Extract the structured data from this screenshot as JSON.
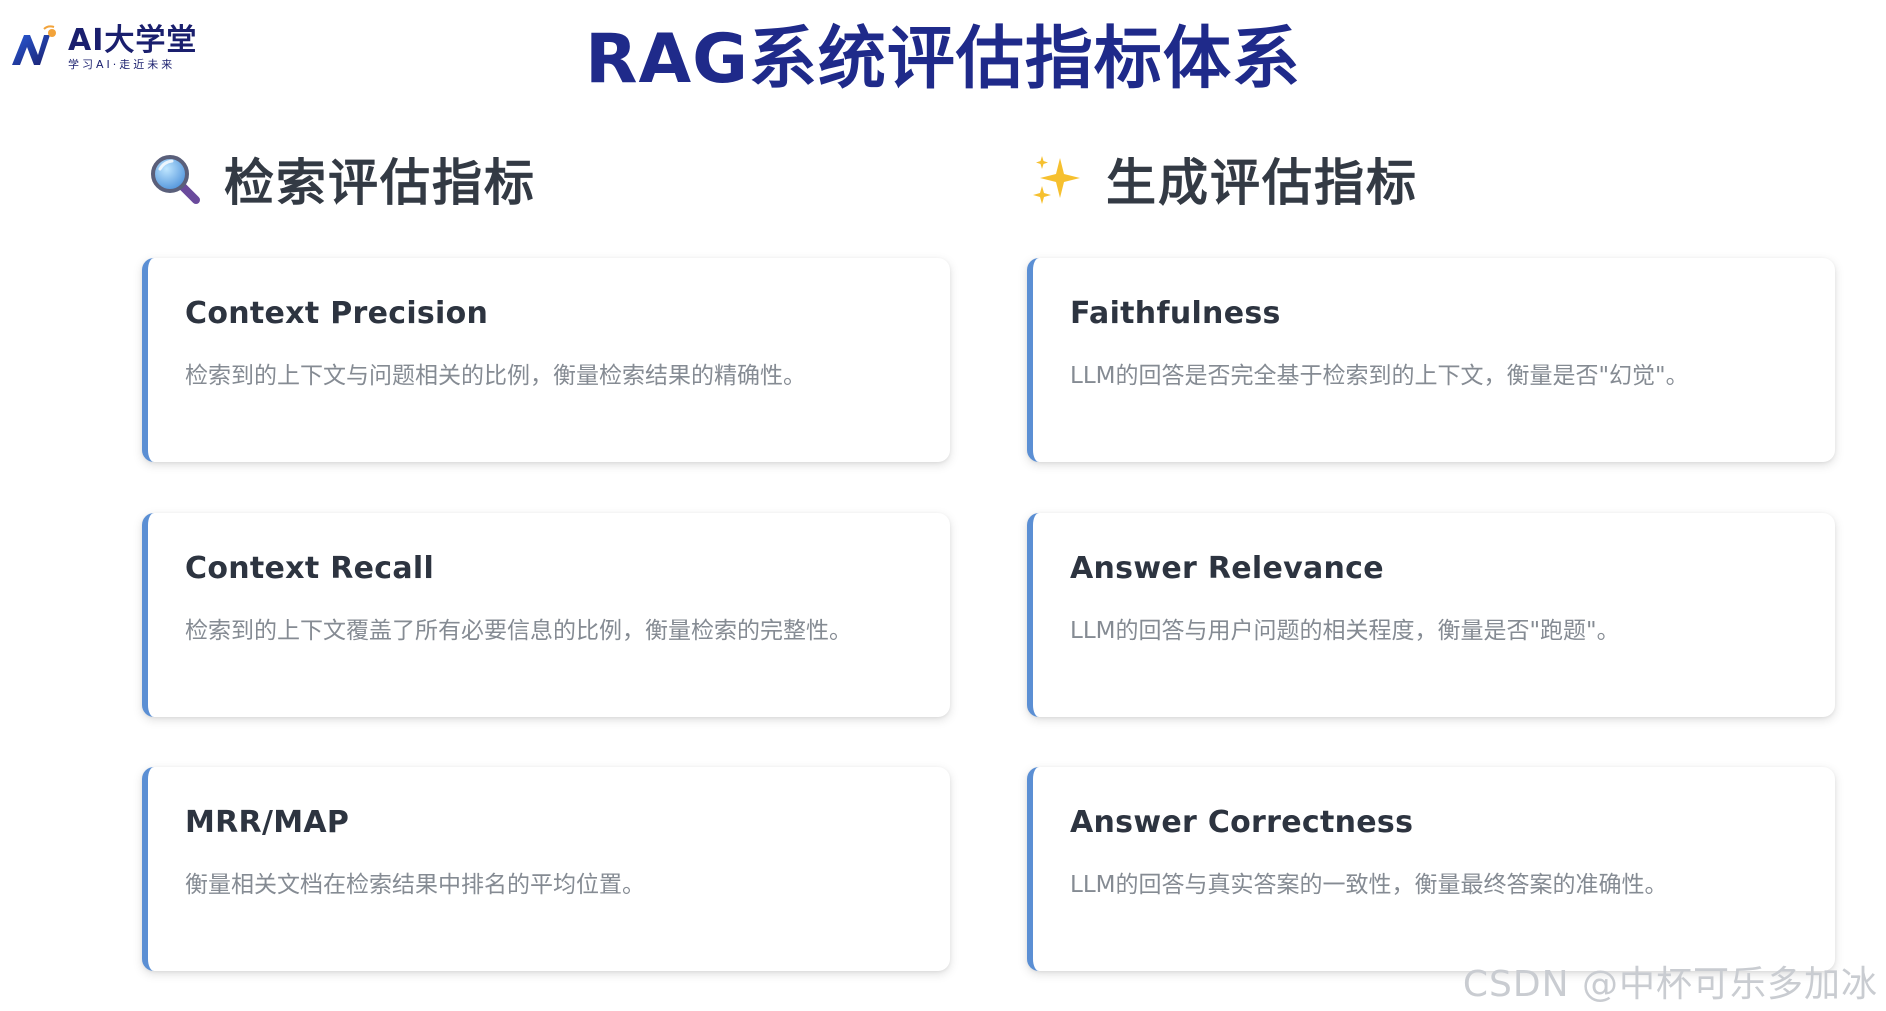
{
  "logo": {
    "title": "AI大学堂",
    "subtitle": "学习AI·走近未来"
  },
  "page_title": "RAG系统评估指标体系",
  "sections": {
    "retrieval": {
      "icon": "magnifying-glass-icon",
      "title": "检索评估指标",
      "cards": [
        {
          "title": "Context Precision",
          "description": "检索到的上下文与问题相关的比例，衡量检索结果的精确性。"
        },
        {
          "title": "Context Recall",
          "description": "检索到的上下文覆盖了所有必要信息的比例，衡量检索的完整性。"
        },
        {
          "title": "MRR/MAP",
          "description": "衡量相关文档在检索结果中排名的平均位置。"
        }
      ]
    },
    "generation": {
      "icon": "sparkles-icon",
      "title": "生成评估指标",
      "cards": [
        {
          "title": "Faithfulness",
          "description": "LLM的回答是否完全基于检索到的上下文，衡量是否\"幻觉\"。"
        },
        {
          "title": "Answer Relevance",
          "description": "LLM的回答与用户问题的相关程度，衡量是否\"跑题\"。"
        },
        {
          "title": "Answer Correctness",
          "description": "LLM的回答与真实答案的一致性，衡量最终答案的准确性。"
        }
      ]
    }
  },
  "watermark": "CSDN @中杯可乐多加冰",
  "colors": {
    "title": "#1f2a8a",
    "card_accent": "#5b8fd4",
    "section_title": "#333a44",
    "description": "#858b93"
  }
}
